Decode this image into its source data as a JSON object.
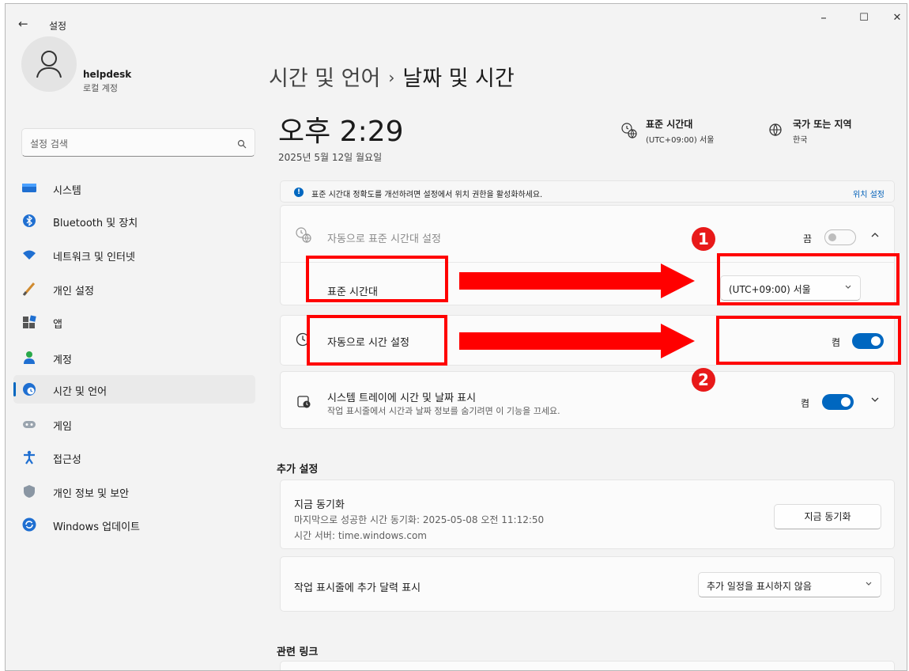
{
  "window": {
    "app_title": "설정",
    "back_glyph": "←",
    "minimize_glyph": "–",
    "maximize_glyph": "☐",
    "close_glyph": "✕"
  },
  "user": {
    "name": "helpdesk",
    "account_type": "로컬 계정"
  },
  "search": {
    "placeholder": "설정 검색"
  },
  "sidebar": {
    "items": [
      {
        "label": "시스템",
        "icon": "monitor-icon"
      },
      {
        "label": "Bluetooth 및 장치",
        "icon": "bluetooth-icon"
      },
      {
        "label": "네트워크 및 인터넷",
        "icon": "wifi-icon"
      },
      {
        "label": "개인 설정",
        "icon": "brush-icon"
      },
      {
        "label": "앱",
        "icon": "apps-icon"
      },
      {
        "label": "계정",
        "icon": "person-icon"
      },
      {
        "label": "시간 및 언어",
        "icon": "globe-clock-icon",
        "selected": true
      },
      {
        "label": "게임",
        "icon": "gamepad-icon"
      },
      {
        "label": "접근성",
        "icon": "accessibility-icon"
      },
      {
        "label": "개인 정보 및 보안",
        "icon": "shield-icon"
      },
      {
        "label": "Windows 업데이트",
        "icon": "update-icon"
      }
    ]
  },
  "header": {
    "breadcrumb_parent": "시간 및 언어",
    "breadcrumb_separator": "›",
    "breadcrumb_current": "날짜 및 시간"
  },
  "clock": {
    "time": "오후 2:29",
    "date": "2025년 5월 12일 월요일"
  },
  "timezone_info": {
    "title": "표준 시간대",
    "value": "(UTC+09:00) 서울"
  },
  "region_info": {
    "title": "국가 또는 지역",
    "value": "한국"
  },
  "banner": {
    "text": "표준 시간대 정확도를 개선하려면 설정에서 위치 권한을 활성화하세요.",
    "link": "위치 설정",
    "icon_glyph": "!"
  },
  "auto_timezone": {
    "label": "자동으로 표준 시간대 설정",
    "state_label": "끔",
    "on": false
  },
  "timezone": {
    "label": "표준 시간대",
    "value": "(UTC+09:00) 서울"
  },
  "auto_time": {
    "label": "자동으로 시간 설정",
    "state_label": "켬",
    "on": true
  },
  "tray": {
    "label": "시스템 트레이에 시간 및 날짜 표시",
    "description": "작업 표시줄에서 시간과 날짜 정보를 숨기려면 이 기능을 끄세요.",
    "state_label": "켬",
    "on": true
  },
  "additional": {
    "section_title": "추가 설정",
    "sync_title": "지금 동기화",
    "last_sync": "마지막으로 성공한 시간 동기화: 2025-05-08 오전 11:12:50",
    "time_server": "시간 서버: time.windows.com",
    "sync_button": "지금 동기화",
    "calendar_label": "작업 표시줄에 추가 달력 표시",
    "calendar_value": "추가 일정을 표시하지 않음"
  },
  "related": {
    "section_title": "관련 링크"
  },
  "annotations": {
    "badge1": "1",
    "badge2": "2",
    "color": "#ff0000"
  },
  "colors": {
    "accent": "#0067c0",
    "annotation": "#ff0000",
    "background": "#f3f3f3",
    "card": "#fbfbfb"
  }
}
